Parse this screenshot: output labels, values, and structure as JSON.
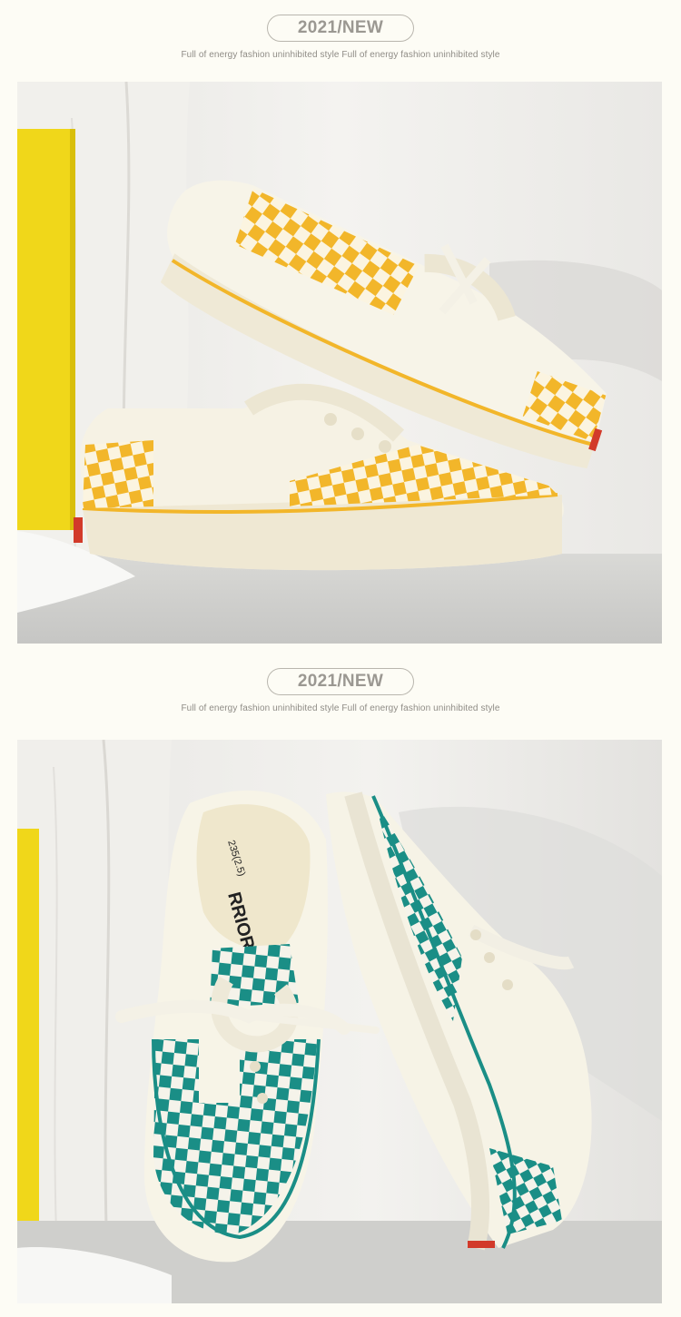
{
  "sections": [
    {
      "badge": "2021/NEW",
      "tagline": "Full of energy fashion  uninhibited style Full of energy fashion  uninhibited style",
      "accent": "#f2b62a"
    },
    {
      "badge": "2021/NEW",
      "tagline": "Full of energy fashion  uninhibited style Full of energy fashion  uninhibited style",
      "accent": "#1a8e86"
    }
  ],
  "insole": {
    "size": "235(2.5)",
    "brand": "RRIOR"
  }
}
